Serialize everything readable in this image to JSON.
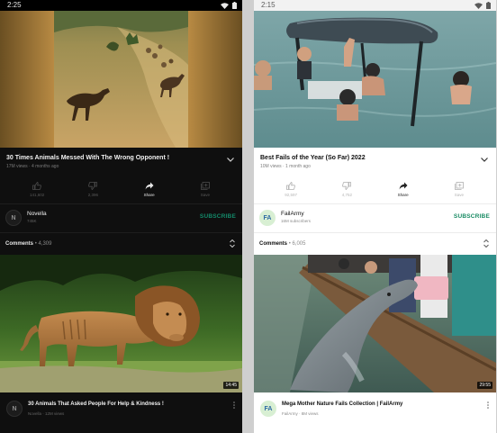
{
  "left_screen": {
    "status_time": "2:25",
    "video": {
      "title": "30 Times Animals Messed With The Wrong Opponent !",
      "meta": "17M views · 4 months ago"
    },
    "actions": [
      {
        "icon": "thumbs-up-icon",
        "label": "141,602"
      },
      {
        "icon": "thumbs-down-icon",
        "label": "2,396"
      },
      {
        "icon": "share-icon",
        "label": "Share"
      },
      {
        "icon": "save-icon",
        "label": "Save"
      }
    ],
    "channel": {
      "initial": "N",
      "name": "Novella",
      "subs": "745K",
      "subscribe_label": "SUBSCRIBE"
    },
    "comments": {
      "label": "Comments",
      "count": "• 4,309"
    },
    "next_video": {
      "duration": "14:45",
      "avatar_initial": "N",
      "title": "30 Animals That Asked People For Help & Kindness !",
      "meta": "Novella · 12M views"
    }
  },
  "right_screen": {
    "status_time": "2:15",
    "video": {
      "title": "Best Fails of the Year (So Far) 2022",
      "meta": "10M views · 1 month ago"
    },
    "actions": [
      {
        "icon": "thumbs-up-icon",
        "label": "92,597"
      },
      {
        "icon": "thumbs-down-icon",
        "label": "4,752"
      },
      {
        "icon": "share-icon",
        "label": "Share"
      },
      {
        "icon": "save-icon",
        "label": "Save"
      }
    ],
    "channel": {
      "initial": "FA",
      "name": "FailArmy",
      "subs": "16M subscribers",
      "subscribe_label": "SUBSCRIBE"
    },
    "comments": {
      "label": "Comments",
      "count": "• 6,005"
    },
    "next_video": {
      "duration": "29:55",
      "avatar_initial": "FA",
      "title": "Mega Mother Nature Fails Collection | FailArmy",
      "meta": "FailArmy · 8M views"
    }
  },
  "colors": {
    "subscribe_green": "#138a6a",
    "dark_bg": "#0f0f0f",
    "light_bg": "#ffffff"
  }
}
